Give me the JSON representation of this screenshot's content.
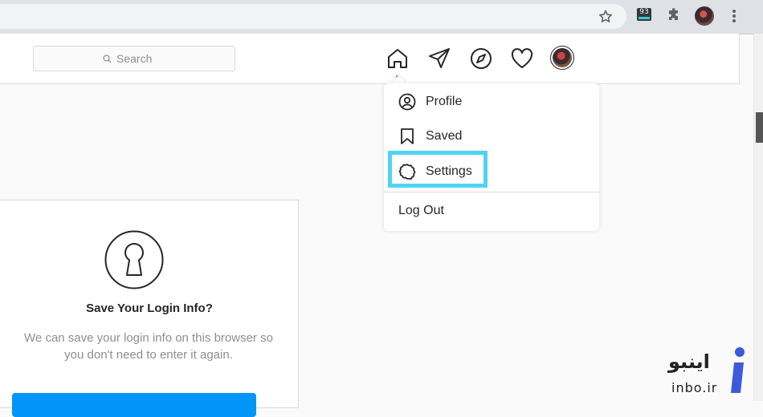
{
  "browser": {
    "extension_badge": "93",
    "icons": [
      "star-icon",
      "extension-icon",
      "puzzle-icon",
      "profile-avatar",
      "kebab-menu-icon"
    ]
  },
  "header": {
    "search": {
      "placeholder": "Search"
    },
    "nav_icons": [
      "home-icon",
      "direct-messages-icon",
      "explore-compass-icon",
      "activity-heart-icon",
      "profile-avatar"
    ],
    "notification_dot_color": "#ed4956"
  },
  "dropdown": {
    "items": [
      {
        "label": "Profile",
        "icon": "profile-circle-icon"
      },
      {
        "label": "Saved",
        "icon": "bookmark-icon"
      },
      {
        "label": "Settings",
        "icon": "gear-icon",
        "highlighted": true
      }
    ],
    "logout_label": "Log Out",
    "highlight_color": "#4fd3f4"
  },
  "card": {
    "title": "Save Your Login Info?",
    "body": "We can save your login info on this browser so you don't need to enter it again.",
    "button_color": "#0095f6"
  },
  "watermark": {
    "persian_text": "اینبو",
    "latin_text": "inbo.ir"
  }
}
